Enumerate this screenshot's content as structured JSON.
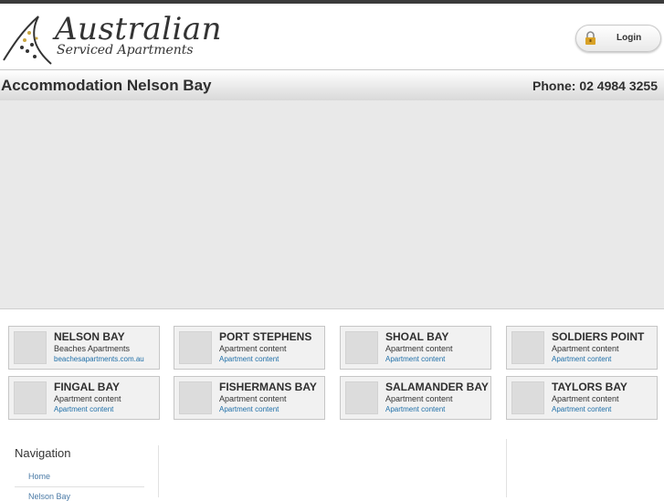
{
  "logo": {
    "title": "Australian",
    "subtitle": "Serviced Apartments",
    "icon": "dotted-leaf-logo-icon"
  },
  "header": {
    "login_label": "Login",
    "login_icon": "padlock-icon"
  },
  "titlebar": {
    "title": "Accommodation Nelson Bay",
    "phone": "Phone: 02 4984 3255"
  },
  "cards": [
    {
      "name": "NELSON BAY",
      "subtitle": "Beaches Apartments",
      "link": "beachesapartments.com.au"
    },
    {
      "name": "PORT STEPHENS",
      "subtitle": "Apartment content",
      "link": "Apartment content"
    },
    {
      "name": "SHOAL BAY",
      "subtitle": "Apartment content",
      "link": "Apartment content"
    },
    {
      "name": "SOLDIERS POINT",
      "subtitle": "Apartment content",
      "link": "Apartment content"
    },
    {
      "name": "FINGAL BAY",
      "subtitle": "Apartment content",
      "link": "Apartment content"
    },
    {
      "name": "FISHERMANS BAY",
      "subtitle": "Apartment content",
      "link": "Apartment content"
    },
    {
      "name": "SALAMANDER BAY",
      "subtitle": "Apartment content",
      "link": "Apartment content"
    },
    {
      "name": "TAYLORS BAY",
      "subtitle": "Apartment content",
      "link": "Apartment content"
    }
  ],
  "navigation": {
    "title": "Navigation",
    "items": [
      "Home",
      "Nelson Bay"
    ]
  },
  "colors": {
    "link": "#1f6fa8",
    "nav_link": "#4a7aa6",
    "top_bar": "#3b3b3b"
  }
}
